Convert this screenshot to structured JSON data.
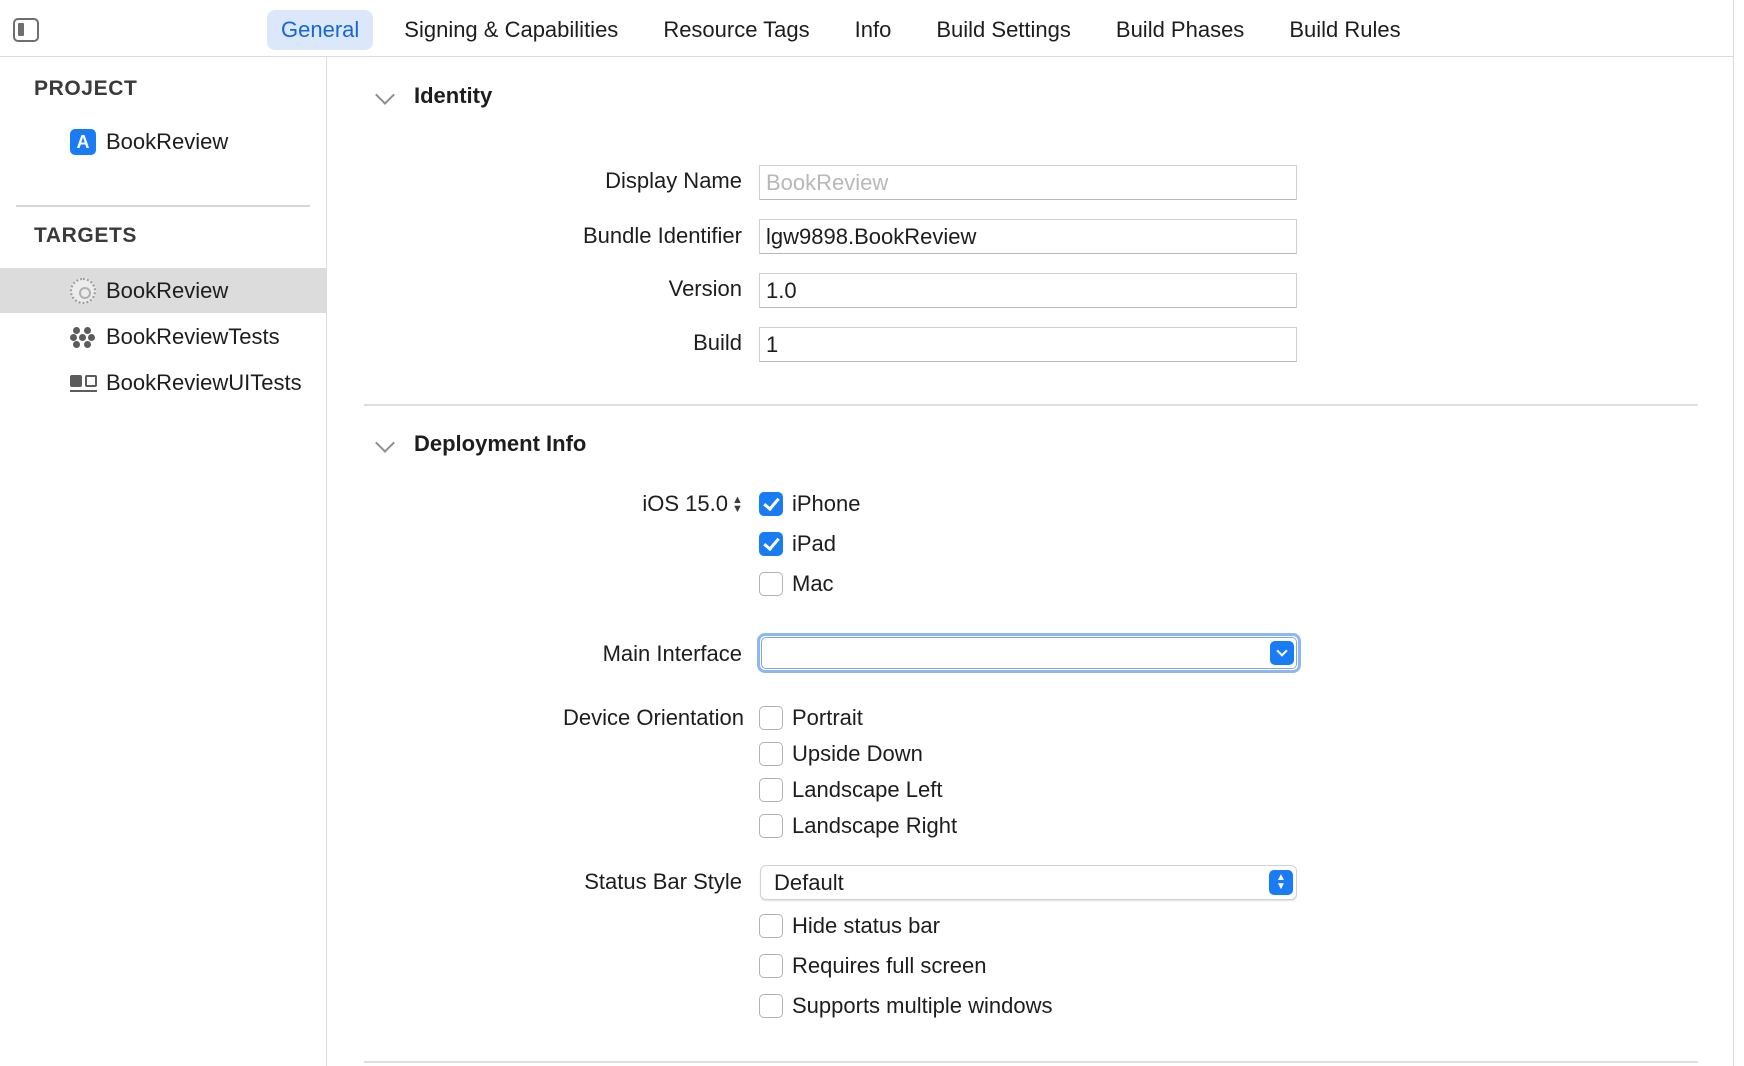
{
  "tabs": [
    {
      "label": "General",
      "active": true
    },
    {
      "label": "Signing & Capabilities",
      "active": false
    },
    {
      "label": "Resource Tags",
      "active": false
    },
    {
      "label": "Info",
      "active": false
    },
    {
      "label": "Build Settings",
      "active": false
    },
    {
      "label": "Build Phases",
      "active": false
    },
    {
      "label": "Build Rules",
      "active": false
    }
  ],
  "sidebar": {
    "project_heading": "PROJECT",
    "project_items": [
      {
        "label": "BookReview",
        "icon": "app-project-icon"
      }
    ],
    "targets_heading": "TARGETS",
    "target_items": [
      {
        "label": "BookReview",
        "icon": "app-target-icon",
        "selected": true
      },
      {
        "label": "BookReviewTests",
        "icon": "unit-tests-icon",
        "selected": false
      },
      {
        "label": "BookReviewUITests",
        "icon": "ui-tests-icon",
        "selected": false
      }
    ]
  },
  "identity": {
    "title": "Identity",
    "display_name_label": "Display Name",
    "display_name_placeholder": "BookReview",
    "bundle_id_label": "Bundle Identifier",
    "bundle_id_value": "lgw9898.BookReview",
    "version_label": "Version",
    "version_value": "1.0",
    "build_label": "Build",
    "build_value": "1"
  },
  "deployment": {
    "title": "Deployment Info",
    "ios_version": "iOS 15.0",
    "devices": [
      {
        "label": "iPhone",
        "checked": true
      },
      {
        "label": "iPad",
        "checked": true
      },
      {
        "label": "Mac",
        "checked": false
      }
    ],
    "main_interface_label": "Main Interface",
    "main_interface_value": "",
    "orientation_label": "Device Orientation",
    "orientations": [
      {
        "label": "Portrait",
        "checked": false
      },
      {
        "label": "Upside Down",
        "checked": false
      },
      {
        "label": "Landscape Left",
        "checked": false
      },
      {
        "label": "Landscape Right",
        "checked": false
      }
    ],
    "status_bar_label": "Status Bar Style",
    "status_bar_value": "Default",
    "status_options": [
      {
        "label": "Hide status bar",
        "checked": false
      },
      {
        "label": "Requires full screen",
        "checked": false
      },
      {
        "label": "Supports multiple windows",
        "checked": false
      }
    ]
  },
  "colors": {
    "accent": "#1a7cf5",
    "selected_tab_bg": "#dbe8fb",
    "selected_row_bg": "#dcdcdc"
  }
}
